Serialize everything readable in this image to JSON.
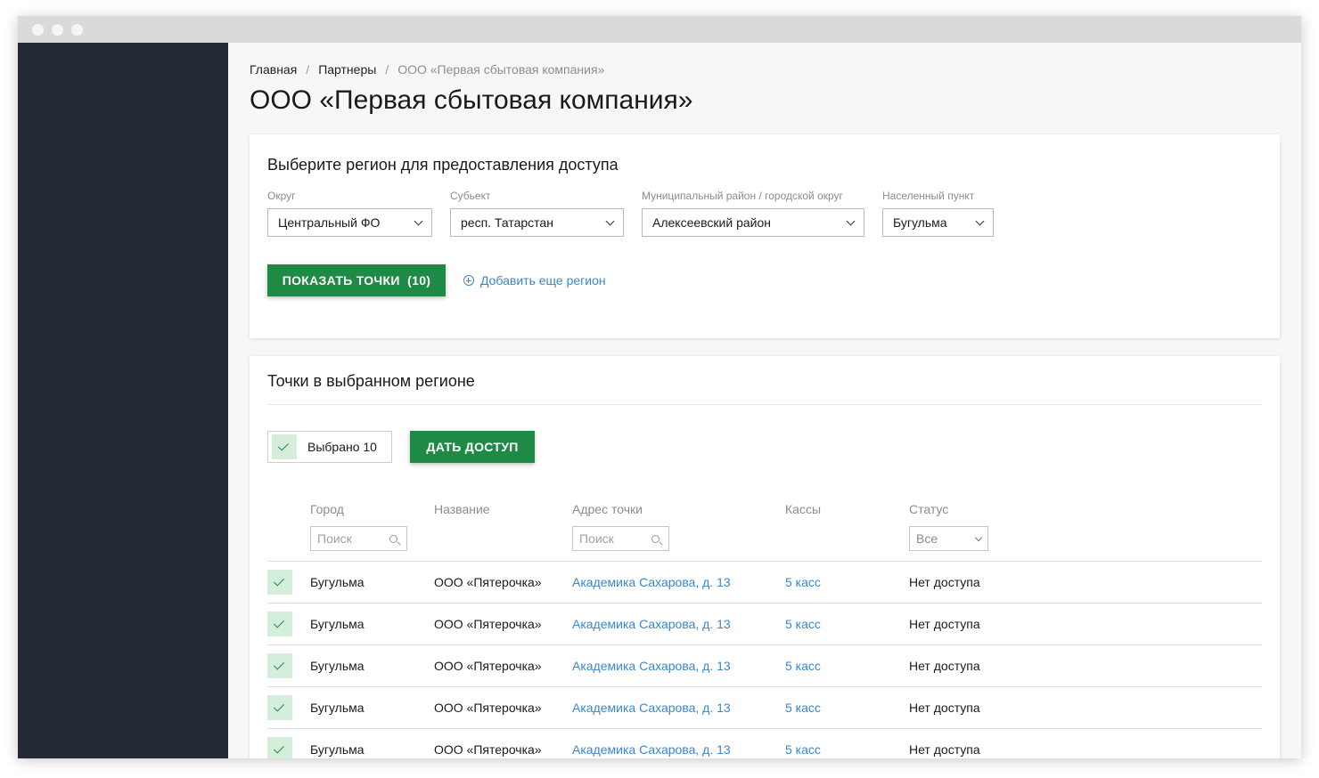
{
  "breadcrumb": {
    "home": "Главная",
    "separator": "/",
    "partners": "Партнеры",
    "current": "ООО «Первая сбытовая компания»"
  },
  "page_title": "ООО «Первая сбытовая компания»",
  "region_card": {
    "title": "Выберите регион для предоставления доступа",
    "fields": [
      {
        "label": "Округ",
        "value": "Центральный ФО"
      },
      {
        "label": "Субьект",
        "value": "респ. Татарстан"
      },
      {
        "label": "Муниципальный район / городской округ",
        "value": "Алексеевский район"
      },
      {
        "label": "Населенный пункт",
        "value": "Бугульма"
      }
    ],
    "show_button": "ПОКАЗАТЬ ТОЧКИ  (10)",
    "add_region": "Добавить еще регион"
  },
  "points_card": {
    "title": "Точки в выбранном регионе",
    "selected_label": "Выбрано 10",
    "grant_button": "ДАТЬ ДОСТУП",
    "columns": {
      "city": "Город",
      "name": "Название",
      "address": "Адрес точки",
      "registers": "Кассы",
      "status": "Статус"
    },
    "filters": {
      "city_placeholder": "Поиск",
      "address_placeholder": "Поиск",
      "status_value": "Все"
    },
    "rows": [
      {
        "city": "Бугульма",
        "name": "ООО «Пятерочка»",
        "address": "Академика Сахарова, д. 13",
        "registers": "5 касс",
        "status": "Нет доступа"
      },
      {
        "city": "Бугульма",
        "name": "ООО «Пятерочка»",
        "address": "Академика Сахарова, д. 13",
        "registers": "5 касс",
        "status": "Нет доступа"
      },
      {
        "city": "Бугульма",
        "name": "ООО «Пятерочка»",
        "address": "Академика Сахарова, д. 13",
        "registers": "5 касс",
        "status": "Нет доступа"
      },
      {
        "city": "Бугульма",
        "name": "ООО «Пятерочка»",
        "address": "Академика Сахарова, д. 13",
        "registers": "5 касс",
        "status": "Нет доступа"
      },
      {
        "city": "Бугульма",
        "name": "ООО «Пятерочка»",
        "address": "Академика Сахарова, д. 13",
        "registers": "5 касс",
        "status": "Нет доступа"
      }
    ]
  },
  "colors": {
    "accent_green": "#1e8a45",
    "link_blue": "#3b86cc",
    "sidebar_bg": "#232a33"
  }
}
